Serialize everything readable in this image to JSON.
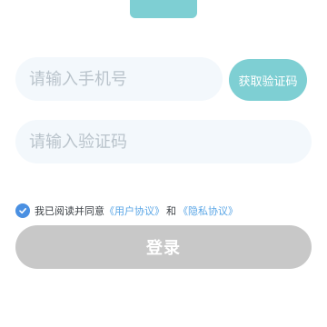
{
  "colors": {
    "accent_teal": "#7ecfd3",
    "field_background": "#f3f8fc",
    "link": "#5aa6e6",
    "checkbox": "#4a90e2",
    "login_button": "#c8c8c8"
  },
  "form": {
    "phone_placeholder": "请输入手机号",
    "code_placeholder": "请输入验证码",
    "get_code_label": "获取验证码"
  },
  "agreement": {
    "checked": true,
    "check_icon": "check-icon",
    "prefix": "我已阅读并同意",
    "user_agreement": "《用户协议》",
    "conjunction": "和",
    "privacy_policy": "《隐私协议》"
  },
  "login": {
    "label": "登录"
  }
}
